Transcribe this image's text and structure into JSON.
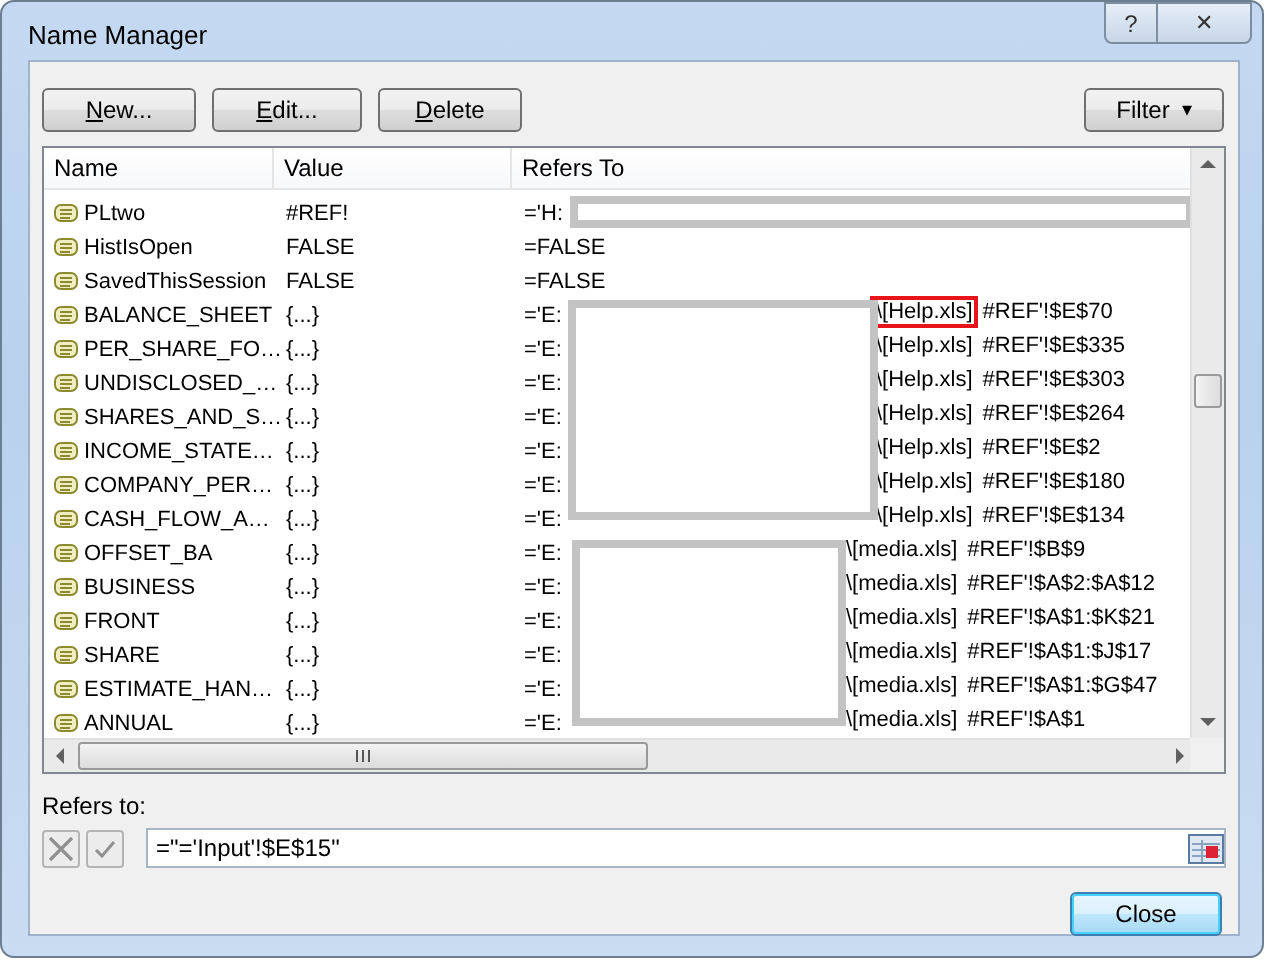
{
  "window": {
    "title": "Name Manager",
    "help_button": "?",
    "close_button": "✕"
  },
  "toolbar": {
    "buttons": [
      "New...",
      "Edit...",
      "Delete"
    ],
    "filter": "Filter",
    "filter_caret": "▾"
  },
  "table": {
    "columns": [
      "Name",
      "Value",
      "Refers To"
    ],
    "rows": [
      {
        "name": "PLtwo",
        "value": "#REF!",
        "refers_to": {
          "start": "='H:"
        }
      },
      {
        "name": "HistIsOpen",
        "value": "FALSE",
        "refers_to": {
          "start": "=FALSE"
        }
      },
      {
        "name": "SavedThisSession",
        "value": "FALSE",
        "refers_to": {
          "start": "=FALSE"
        }
      },
      {
        "name": "BALANCE_SHEET",
        "value": "{...}",
        "refers_to": {
          "start": "='E:",
          "file": "\\[Help.xls]",
          "ref": "#REF'!$E$70",
          "highlighted": true
        }
      },
      {
        "name": "PER_SHARE_FO…",
        "value": "{...}",
        "refers_to": {
          "start": "='E:",
          "file": "\\[Help.xls]",
          "ref": "#REF'!$E$335",
          "highlighted": false
        }
      },
      {
        "name": "UNDISCLOSED_…",
        "value": "{...}",
        "refers_to": {
          "start": "='E:",
          "file": "\\[Help.xls]",
          "ref": "#REF'!$E$303",
          "highlighted": false
        }
      },
      {
        "name": "SHARES_AND_S…",
        "value": "{...}",
        "refers_to": {
          "start": "='E:",
          "file": "\\[Help.xls]",
          "ref": "#REF'!$E$264",
          "highlighted": false
        }
      },
      {
        "name": "INCOME_STATE…",
        "value": "{...}",
        "refers_to": {
          "start": "='E:",
          "file": "\\[Help.xls]",
          "ref": "#REF'!$E$2",
          "highlighted": false
        }
      },
      {
        "name": "COMPANY_PER…",
        "value": "{...}",
        "refers_to": {
          "start": "='E:",
          "file": "\\[Help.xls]",
          "ref": "#REF'!$E$180",
          "highlighted": false
        }
      },
      {
        "name": "CASH_FLOW_A…",
        "value": "{...}",
        "refers_to": {
          "start": "='E:",
          "file": "\\[Help.xls]",
          "ref": "#REF'!$E$134",
          "highlighted": false
        }
      },
      {
        "name": "OFFSET_BA",
        "value": "{...}",
        "refers_to": {
          "start": "='E:",
          "file": "\\[media.xls]",
          "ref": "#REF'!$B$9",
          "highlighted": false
        }
      },
      {
        "name": "BUSINESS",
        "value": "{...}",
        "refers_to": {
          "start": "='E:",
          "file": "\\[media.xls]",
          "ref": "#REF'!$A$2:$A$12",
          "highlighted": false
        }
      },
      {
        "name": "FRONT",
        "value": "{...}",
        "refers_to": {
          "start": "='E:",
          "file": "\\[media.xls]",
          "ref": "#REF'!$A$1:$K$21",
          "highlighted": false
        }
      },
      {
        "name": "SHARE",
        "value": "{...}",
        "refers_to": {
          "start": "='E:",
          "file": "\\[media.xls]",
          "ref": "#REF'!$A$1:$J$17",
          "highlighted": false
        }
      },
      {
        "name": "ESTIMATE_HAN…",
        "value": "{...}",
        "refers_to": {
          "start": "='E:",
          "file": "\\[media.xls]",
          "ref": "#REF'!$A$1:$G$47",
          "highlighted": false
        }
      },
      {
        "name": "ANNUAL",
        "value": "{...}",
        "refers_to": {
          "start": "='E:",
          "file": "\\[media.xls]",
          "ref": "#REF'!$A$1",
          "highlighted": false
        }
      }
    ]
  },
  "refers_to_bar": {
    "label": "Refers to:",
    "value": "=\"='Input'!$E$15\""
  },
  "footer": {
    "button": "Close"
  }
}
